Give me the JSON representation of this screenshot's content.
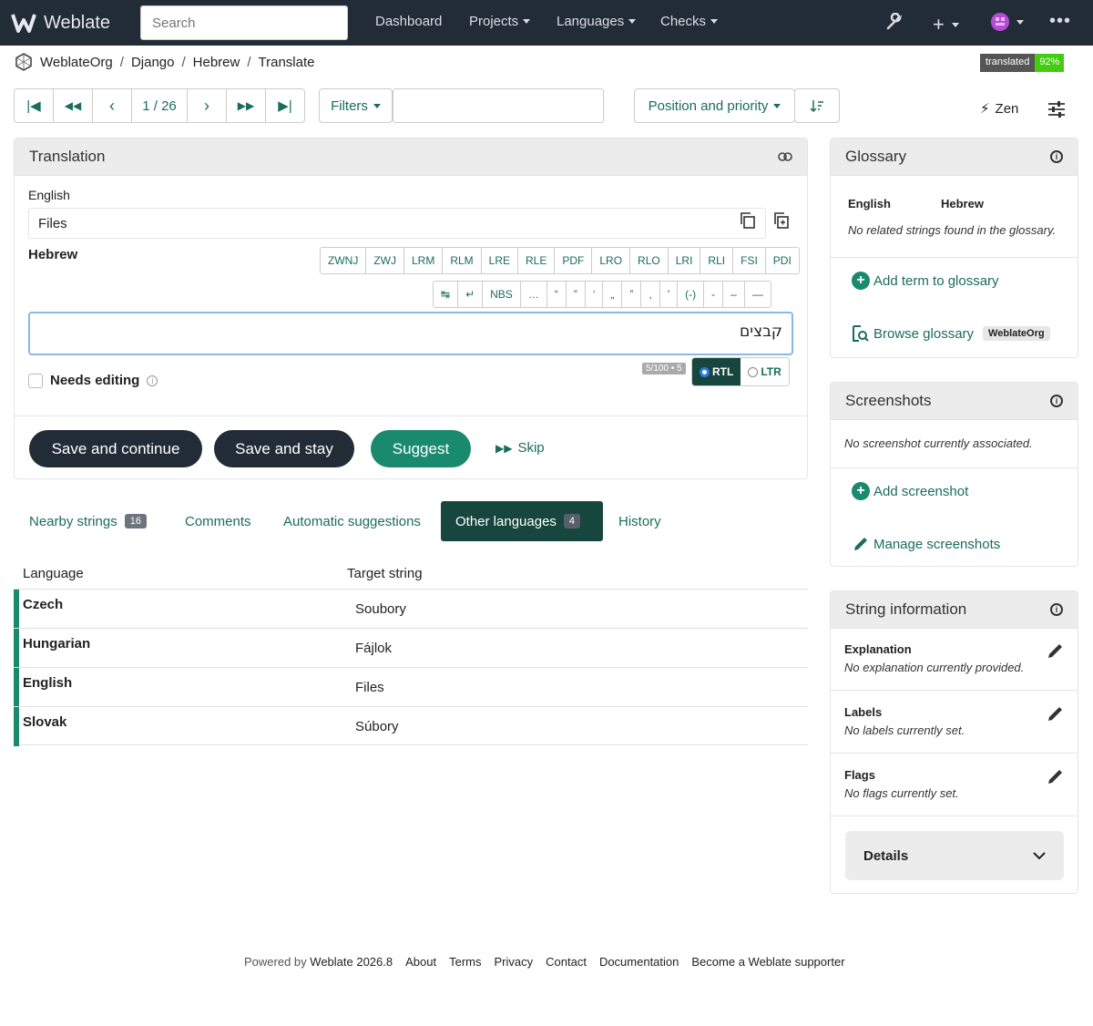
{
  "navbar": {
    "brand": "Weblate",
    "search_placeholder": "Search",
    "items": [
      "Dashboard",
      "Projects",
      "Languages",
      "Checks"
    ],
    "icons": [
      "wrench-icon",
      "plus-icon",
      "avatar",
      "more-icon"
    ]
  },
  "breadcrumb": [
    "WeblateOrg",
    "Django",
    "Hebrew",
    "Translate"
  ],
  "badge": {
    "label": "translated",
    "value": "92%",
    "color": "#44cc11"
  },
  "toolbar": {
    "position": "1 / 26",
    "filters_label": "Filters",
    "sort_label": "Position and priority",
    "zen_label": "Zen"
  },
  "translation": {
    "title": "Translation",
    "source_language": "English",
    "source_text": "Files",
    "target_language": "Hebrew",
    "special_chars_row1": [
      "ZWNJ",
      "ZWJ",
      "LRM",
      "RLM",
      "LRE",
      "RLE",
      "PDF",
      "LRO",
      "RLO",
      "LRI",
      "RLI",
      "FSI",
      "PDI"
    ],
    "special_chars_row2": [
      "↹",
      "↵",
      "NBS",
      "…",
      "“",
      "”",
      "‘",
      "„",
      "‟",
      ",",
      "'",
      "(-)",
      "-",
      "–",
      "—"
    ],
    "target_text": "קבצים",
    "counter": "5/100 • 5",
    "rtl_label": "RTL",
    "ltr_label": "LTR",
    "needs_editing_label": "Needs editing",
    "save_continue": "Save and continue",
    "save_stay": "Save and stay",
    "suggest": "Suggest",
    "skip": "Skip"
  },
  "tabs": [
    {
      "label": "Nearby strings",
      "count": "16"
    },
    {
      "label": "Comments",
      "count": null
    },
    {
      "label": "Automatic suggestions",
      "count": null
    },
    {
      "label": "Other languages",
      "count": "4",
      "active": true
    },
    {
      "label": "History",
      "count": null
    }
  ],
  "other_languages": {
    "headers": [
      "Language",
      "Target string"
    ],
    "rows": [
      {
        "language": "Czech",
        "target": "Soubory"
      },
      {
        "language": "Hungarian",
        "target": "Fájlok"
      },
      {
        "language": "English",
        "target": "Files"
      },
      {
        "language": "Slovak",
        "target": "Súbory"
      }
    ]
  },
  "glossary": {
    "title": "Glossary",
    "col_source": "English",
    "col_target": "Hebrew",
    "empty": "No related strings found in the glossary.",
    "add_term": "Add term to glossary",
    "browse": "Browse glossary",
    "project_tag": "WeblateOrg"
  },
  "screenshots": {
    "title": "Screenshots",
    "empty": "No screenshot currently associated.",
    "add": "Add screenshot",
    "manage": "Manage screenshots"
  },
  "string_info": {
    "title": "String information",
    "explanation_label": "Explanation",
    "explanation_value": "No explanation currently provided.",
    "labels_label": "Labels",
    "labels_value": "No labels currently set.",
    "flags_label": "Flags",
    "flags_value": "No flags currently set.",
    "details_label": "Details"
  },
  "footer": {
    "powered_prefix": "Powered by",
    "powered_link": "Weblate 2026.8",
    "links": [
      "About",
      "Terms",
      "Privacy",
      "Contact",
      "Documentation",
      "Become a Weblate supporter"
    ]
  },
  "colors": {
    "navbar": "#222c37",
    "accent": "#1a6d5b",
    "green": "#1a8a6e"
  }
}
